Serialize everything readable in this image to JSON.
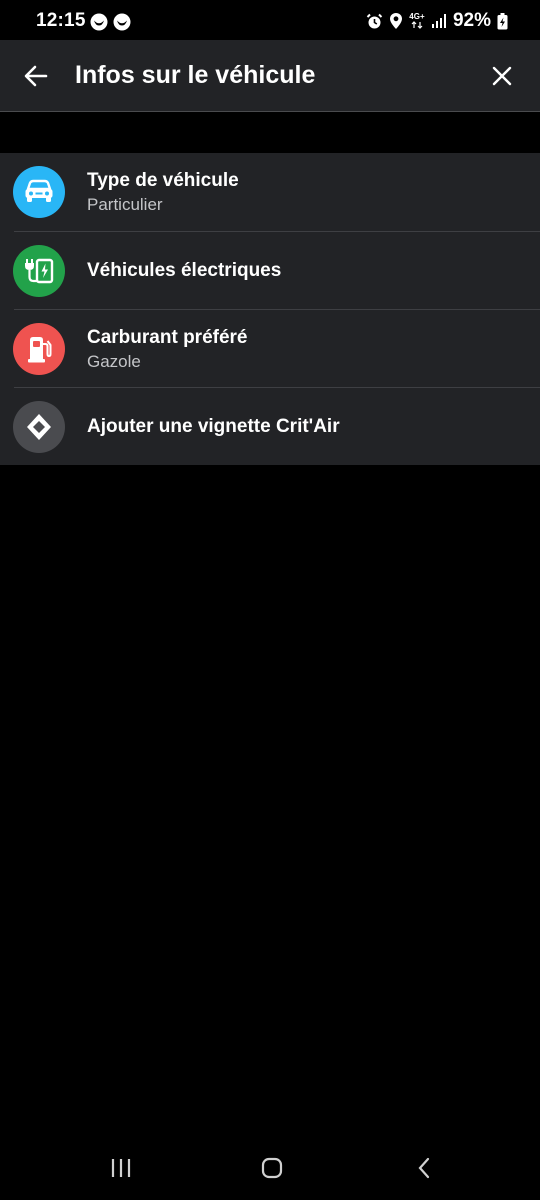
{
  "status_bar": {
    "time": "12:15",
    "network": "4G+",
    "battery": "92%"
  },
  "header": {
    "title": "Infos sur le véhicule",
    "back_icon": "arrow-left-icon",
    "close_icon": "close-icon"
  },
  "items": [
    {
      "title": "Type de véhicule",
      "subtitle": "Particulier",
      "icon": "car-icon",
      "color": "#29b6f6"
    },
    {
      "title": "Véhicules électriques",
      "subtitle": "",
      "icon": "ev-charger-icon",
      "color": "#22a24a"
    },
    {
      "title": "Carburant préféré",
      "subtitle": "Gazole",
      "icon": "fuel-pump-icon",
      "color": "#ef5350"
    },
    {
      "title": "Ajouter une vignette Crit'Air",
      "subtitle": "",
      "icon": "critair-diamond-icon",
      "color": "#4a4b4f"
    }
  ],
  "colors": {
    "surface": "#222326",
    "background": "#000000",
    "divider": "#3e3f43",
    "subtitle": "#c4c5c8"
  }
}
